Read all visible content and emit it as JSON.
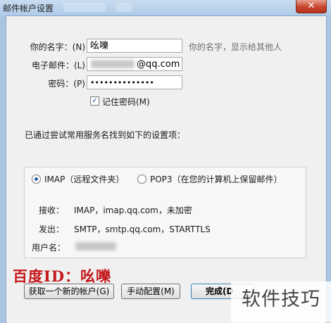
{
  "window": {
    "title": "邮件帐户设置",
    "close_glyph": "✕"
  },
  "form": {
    "name_label": "你的名字：(N)",
    "name_value": "吆嚛",
    "name_hint": "你的名字，显示给其他人",
    "email_label": "电子邮件：(L)",
    "email_value": "@qq.com",
    "password_label": "密码：(P)",
    "password_value": "••••••••••••••",
    "remember_label": "记住密码(M)",
    "remember_checked": true,
    "remember_check_glyph": "✓"
  },
  "status_text": "已通过尝试常用服务名找到如下的设置项：",
  "settings": {
    "protocol_options": [
      {
        "label": "IMAP（远程文件夹）",
        "selected": true
      },
      {
        "label": "POP3（在您的计算机上保留邮件）",
        "selected": false
      }
    ],
    "incoming_label": "接收：",
    "incoming_value": "IMAP，imap.qq.com，未加密",
    "outgoing_label": "发出：",
    "outgoing_value": "SMTP，smtp.qq.com，STARTTLS",
    "username_label": "用户名："
  },
  "buttons": {
    "new_account": "获取一个新的帐户(G)",
    "manual_config": "手动配置(M)",
    "done": "完成(D"
  },
  "watermark": {
    "left_text": "百度ID：吆嚛",
    "right_text": "软件技巧"
  }
}
